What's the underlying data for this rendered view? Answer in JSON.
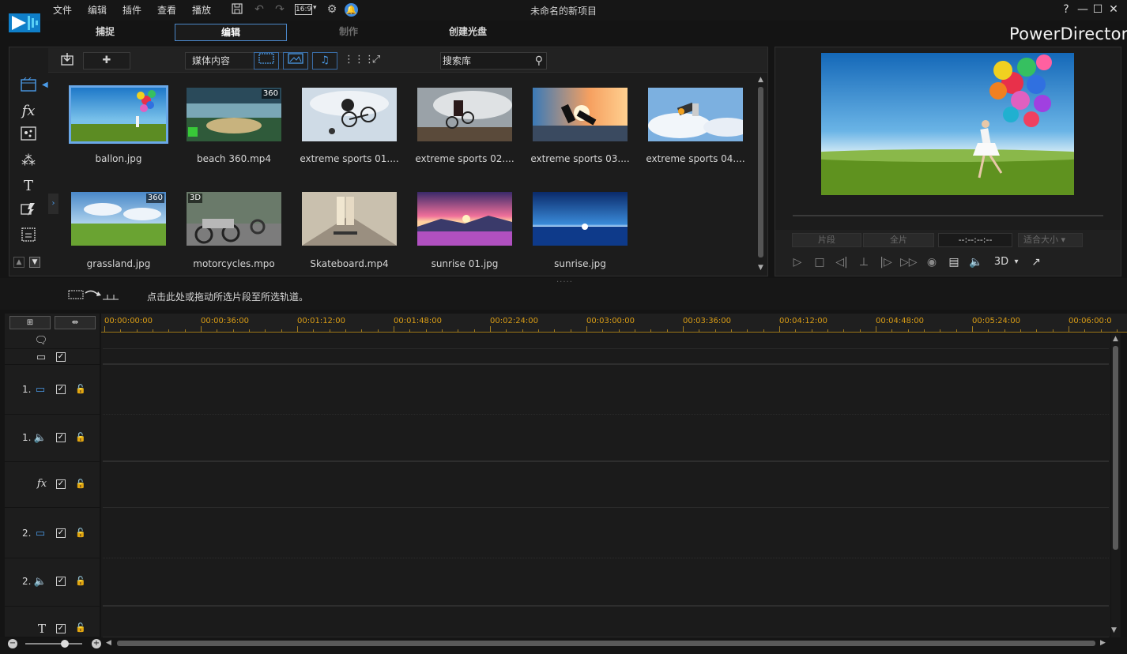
{
  "menu": [
    "文件",
    "编辑",
    "插件",
    "查看",
    "播放"
  ],
  "window": {
    "title": "未命名的新项目",
    "help": "?",
    "minimize": "—",
    "maximize": "☐",
    "close": "✕"
  },
  "aspect": "16:9",
  "modes": [
    {
      "label": "捕捉",
      "state": "normal"
    },
    {
      "label": "编辑",
      "state": "active"
    },
    {
      "label": "制作",
      "state": "disabled"
    },
    {
      "label": "创建光盘",
      "state": "normal"
    }
  ],
  "brand": "PowerDirector",
  "library": {
    "select": "媒体内容",
    "search_placeholder": "搜索库",
    "items": [
      {
        "name": "ballon.jpg",
        "selected": true,
        "badge": ""
      },
      {
        "name": "beach 360.mp4",
        "selected": false,
        "badge": "360"
      },
      {
        "name": "extreme sports 01....",
        "selected": false,
        "badge": ""
      },
      {
        "name": "extreme sports 02....",
        "selected": false,
        "badge": ""
      },
      {
        "name": "extreme sports 03....",
        "selected": false,
        "badge": ""
      },
      {
        "name": "extreme sports 04....",
        "selected": false,
        "badge": ""
      },
      {
        "name": "grassland.jpg",
        "selected": false,
        "badge": "360"
      },
      {
        "name": "motorcycles.mpo",
        "selected": false,
        "badge": "3D"
      },
      {
        "name": "Skateboard.mp4",
        "selected": false,
        "badge": ""
      },
      {
        "name": "sunrise 01.jpg",
        "selected": false,
        "badge": ""
      },
      {
        "name": "sunrise.jpg",
        "selected": false,
        "badge": ""
      }
    ]
  },
  "preview": {
    "clip_label": "片段",
    "movie_label": "全片",
    "timecode": "--:--:--:--",
    "fit_label": "适合大小",
    "mode_3d": "3D"
  },
  "hint": "点击此处或拖动所选片段至所选轨道。",
  "timeline": {
    "ticks": [
      "00:00:00:00",
      "00:00:36:00",
      "00:01:12:00",
      "00:01:48:00",
      "00:02:24:00",
      "00:03:00:00",
      "00:03:36:00",
      "00:04:12:00",
      "00:04:48:00",
      "00:05:24:00",
      "00:06:00:0"
    ],
    "tracks": [
      {
        "num": "1.",
        "kind": "video"
      },
      {
        "num": "1.",
        "kind": "audio"
      },
      {
        "num": "",
        "kind": "fx"
      },
      {
        "num": "2.",
        "kind": "video"
      },
      {
        "num": "2.",
        "kind": "audio"
      },
      {
        "num": "",
        "kind": "title"
      }
    ]
  },
  "colors": {
    "accent": "#4b86c8",
    "ruler": "#d89c16",
    "background": "#141414"
  }
}
